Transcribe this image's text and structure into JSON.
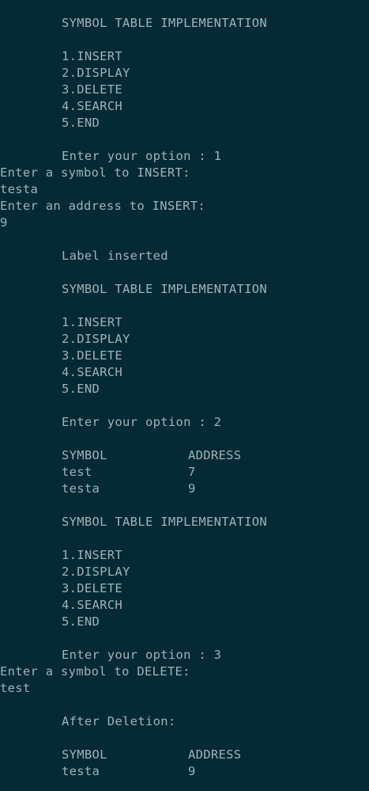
{
  "terminal": {
    "lines": [
      {
        "text": "SYMBOL TABLE IMPLEMENTATION",
        "indent": true
      },
      {
        "text": "",
        "indent": true
      },
      {
        "text": "1.INSERT",
        "indent": true
      },
      {
        "text": "2.DISPLAY",
        "indent": true
      },
      {
        "text": "3.DELETE",
        "indent": true
      },
      {
        "text": "4.SEARCH",
        "indent": true
      },
      {
        "text": "5.END",
        "indent": true
      },
      {
        "text": "",
        "indent": true
      },
      {
        "text": "Enter your option : 1",
        "indent": true
      },
      {
        "text": "Enter a symbol to INSERT:",
        "indent": false
      },
      {
        "text": "testa",
        "indent": false
      },
      {
        "text": "Enter an address to INSERT:",
        "indent": false
      },
      {
        "text": "9",
        "indent": false
      },
      {
        "text": "",
        "indent": true
      },
      {
        "text": "Label inserted",
        "indent": true
      },
      {
        "text": "",
        "indent": true
      },
      {
        "text": "SYMBOL TABLE IMPLEMENTATION",
        "indent": true
      },
      {
        "text": "",
        "indent": true
      },
      {
        "text": "1.INSERT",
        "indent": true
      },
      {
        "text": "2.DISPLAY",
        "indent": true
      },
      {
        "text": "3.DELETE",
        "indent": true
      },
      {
        "text": "4.SEARCH",
        "indent": true
      },
      {
        "text": "5.END",
        "indent": true
      },
      {
        "text": "",
        "indent": true
      },
      {
        "text": "Enter your option : 2",
        "indent": true
      },
      {
        "text": "",
        "indent": true
      },
      {
        "text": "SYMBOL",
        "col2": "ADDRESS",
        "indent": true
      },
      {
        "text": "test",
        "col2": "7",
        "indent": true
      },
      {
        "text": "testa",
        "col2": "9",
        "indent": true
      },
      {
        "text": "",
        "indent": true
      },
      {
        "text": "SYMBOL TABLE IMPLEMENTATION",
        "indent": true
      },
      {
        "text": "",
        "indent": true
      },
      {
        "text": "1.INSERT",
        "indent": true
      },
      {
        "text": "2.DISPLAY",
        "indent": true
      },
      {
        "text": "3.DELETE",
        "indent": true
      },
      {
        "text": "4.SEARCH",
        "indent": true
      },
      {
        "text": "5.END",
        "indent": true
      },
      {
        "text": "",
        "indent": true
      },
      {
        "text": "Enter your option : 3",
        "indent": true
      },
      {
        "text": "Enter a symbol to DELETE:",
        "indent": false
      },
      {
        "text": "test",
        "indent": false
      },
      {
        "text": "",
        "indent": true
      },
      {
        "text": "After Deletion:",
        "indent": true
      },
      {
        "text": "",
        "indent": true
      },
      {
        "text": "SYMBOL",
        "col2": "ADDRESS",
        "indent": true
      },
      {
        "text": "testa",
        "col2": "9",
        "indent": true
      }
    ]
  }
}
